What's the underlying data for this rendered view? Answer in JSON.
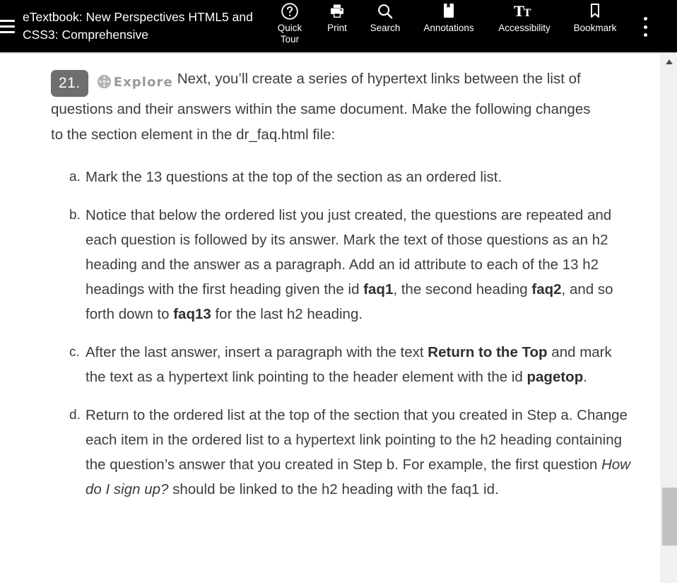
{
  "toolbar": {
    "menu_icon": "hamburger-icon",
    "book_title": "eTextbook: New Perspectives HTML5 and CSS3: Comprehensive",
    "buttons": [
      {
        "id": "quick-tour",
        "label_line1": "Quick",
        "label_line2": "Tour",
        "icon": "question-circle-icon"
      },
      {
        "id": "print",
        "label_line1": "Print",
        "label_line2": "",
        "icon": "printer-icon"
      },
      {
        "id": "search",
        "label_line1": "Search",
        "label_line2": "",
        "icon": "magnifier-icon"
      },
      {
        "id": "annotations",
        "label_line1": "Annotations",
        "label_line2": "",
        "icon": "note-bookmark-icon"
      },
      {
        "id": "accessibility",
        "label_line1": "Accessibility",
        "label_line2": "",
        "icon": "text-size-icon"
      },
      {
        "id": "bookmark",
        "label_line1": "Bookmark",
        "label_line2": "",
        "icon": "bookmark-icon"
      }
    ],
    "overflow_icon": "kebab-menu-icon",
    "background_color": "#000000",
    "text_color": "#ffffff"
  },
  "content": {
    "step_number": "21.",
    "explore_label": "Explore",
    "explore_icon": "compass-arrows-icon",
    "intro_text": "Next, you’ll create a series of hypertext links between the list of questions and their answers within the same document. Make the following changes to the section element in the dr_faq.html file:",
    "substeps": [
      {
        "marker": "a.",
        "parts": [
          {
            "text": "Mark the 13 questions at the top of the section as an ordered list.",
            "style": "normal"
          }
        ]
      },
      {
        "marker": "b.",
        "parts": [
          {
            "text": "Notice that below the ordered list you just created, the questions are repeated and each question is followed by its answer. Mark the text of those questions as an h2 heading and the answer as a paragraph. Add an id attribute to each of the 13 h2 headings with the first heading given the id ",
            "style": "normal"
          },
          {
            "text": "faq1",
            "style": "bold"
          },
          {
            "text": ", the second heading ",
            "style": "normal"
          },
          {
            "text": "faq2",
            "style": "bold"
          },
          {
            "text": ", and so forth down to ",
            "style": "normal"
          },
          {
            "text": "faq13",
            "style": "bold"
          },
          {
            "text": " for the last h2 heading.",
            "style": "normal"
          }
        ]
      },
      {
        "marker": "c.",
        "parts": [
          {
            "text": "After the last answer, insert a paragraph with the text ",
            "style": "normal"
          },
          {
            "text": "Return to the Top",
            "style": "bold"
          },
          {
            "text": " and mark the text as a hypertext link pointing to the header element with the id ",
            "style": "normal"
          },
          {
            "text": "pagetop",
            "style": "bold"
          },
          {
            "text": ".",
            "style": "normal"
          }
        ]
      },
      {
        "marker": "d.",
        "parts": [
          {
            "text": "Return to the ordered list at the top of the section that you created in Step a. Change each item in the ordered list to a hypertext link pointing to the h2 heading containing the question’s answer that you created in Step b. For example, the first question ",
            "style": "normal"
          },
          {
            "text": "How do I sign up?",
            "style": "italic"
          },
          {
            "text": " should be linked to the h2 heading with the faq1 id.",
            "style": "normal"
          }
        ]
      }
    ],
    "badge_color": "#6e6e6e",
    "text_color": "#3d3d3d",
    "explore_color": "#9a9a9a"
  },
  "scrollbar": {
    "up_arrow_icon": "scroll-up-arrow-icon",
    "track_color": "#f1f1f1",
    "thumb_color": "#c1c1c1"
  }
}
